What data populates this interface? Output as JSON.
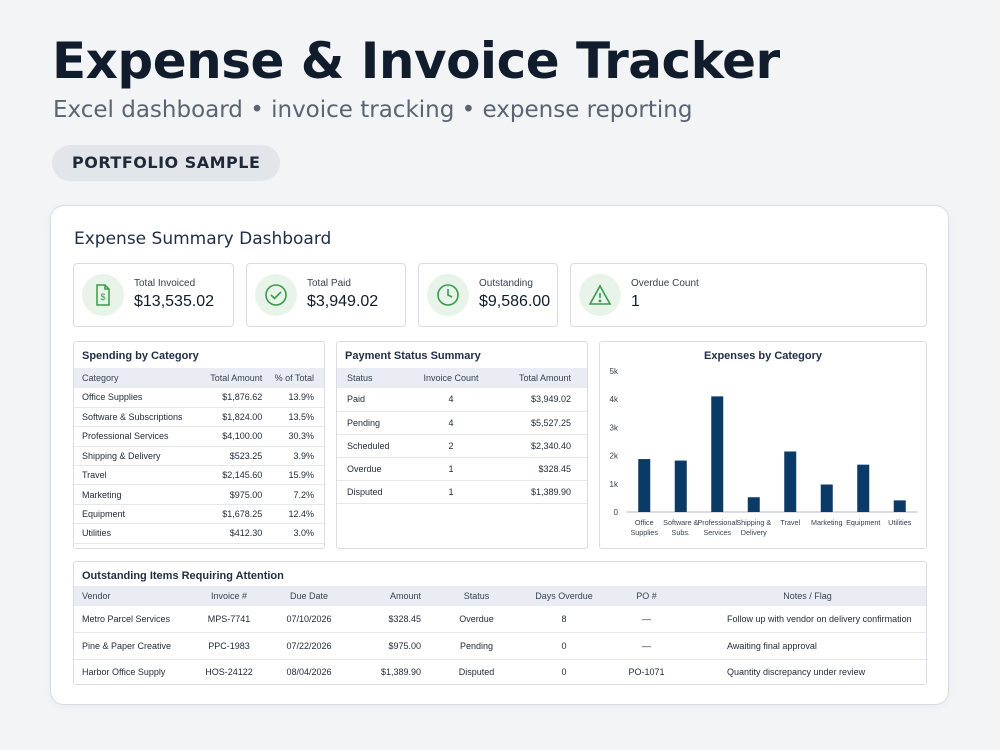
{
  "header": {
    "title": "Expense & Invoice Tracker",
    "subtitle": "Excel dashboard • invoice tracking • expense reporting",
    "badge": "PORTFOLIO SAMPLE"
  },
  "dashboard": {
    "title": "Expense Summary Dashboard",
    "kpis": [
      {
        "label": "Total Invoiced",
        "value": "$13,535.02",
        "icon": "document-dollar-icon"
      },
      {
        "label": "Total Paid",
        "value": "$3,949.02",
        "icon": "check-circle-icon"
      },
      {
        "label": "Outstanding",
        "value": "$9,586.00",
        "icon": "clock-icon"
      },
      {
        "label": "Overdue Count",
        "value": "1",
        "icon": "warning-triangle-icon"
      }
    ]
  },
  "spending": {
    "title": "Spending by Category",
    "headers": [
      "Category",
      "Total Amount",
      "% of Total"
    ],
    "rows": [
      [
        "Office Supplies",
        "$1,876.62",
        "13.9%"
      ],
      [
        "Software & Subscriptions",
        "$1,824.00",
        "13.5%"
      ],
      [
        "Professional Services",
        "$4,100.00",
        "30.3%"
      ],
      [
        "Shipping & Delivery",
        "$523.25",
        "3.9%"
      ],
      [
        "Travel",
        "$2,145.60",
        "15.9%"
      ],
      [
        "Marketing",
        "$975.00",
        "7.2%"
      ],
      [
        "Equipment",
        "$1,678.25",
        "12.4%"
      ],
      [
        "Utilities",
        "$412.30",
        "3.0%"
      ]
    ]
  },
  "payment": {
    "title": "Payment Status Summary",
    "headers": [
      "Status",
      "Invoice Count",
      "Total Amount"
    ],
    "rows": [
      [
        "Paid",
        "4",
        "$3,949.02"
      ],
      [
        "Pending",
        "4",
        "$5,527.25"
      ],
      [
        "Scheduled",
        "2",
        "$2,340.40"
      ],
      [
        "Overdue",
        "1",
        "$328.45"
      ],
      [
        "Disputed",
        "1",
        "$1,389.90"
      ]
    ]
  },
  "outstanding": {
    "title": "Outstanding Items Requiring Attention",
    "headers": [
      "Vendor",
      "Invoice #",
      "Due Date",
      "Amount",
      "Status",
      "Days Overdue",
      "PO #",
      "Notes / Flag"
    ],
    "rows": [
      [
        "Metro Parcel Services",
        "MPS-7741",
        "07/10/2026",
        "$328.45",
        "Overdue",
        "8",
        "—",
        "Follow up with vendor on delivery confirmation"
      ],
      [
        "Pine & Paper Creative",
        "PPC-1983",
        "07/22/2026",
        "$975.00",
        "Pending",
        "0",
        "—",
        "Awaiting final approval"
      ],
      [
        "Harbor Office Supply",
        "HOS-24122",
        "08/04/2026",
        "$1,389.90",
        "Disputed",
        "0",
        "PO-1071",
        "Quantity discrepancy under review"
      ]
    ]
  },
  "chart_data": {
    "type": "bar",
    "title": "Expenses by Category",
    "categories": [
      [
        "Office",
        "Supplies"
      ],
      [
        "Software &",
        "Subs."
      ],
      [
        "Professional",
        "Services"
      ],
      [
        "Shipping &",
        "Delivery"
      ],
      [
        "Travel"
      ],
      [
        "Marketing"
      ],
      [
        "Equipment"
      ],
      [
        "Utilities"
      ]
    ],
    "values": [
      1876.62,
      1824.0,
      4100.0,
      523.25,
      2145.6,
      975.0,
      1678.25,
      412.3
    ],
    "ylim": [
      0,
      5000
    ],
    "yticks": [
      "0",
      "1k",
      "2k",
      "3k",
      "4k",
      "5k"
    ],
    "bar_color": "#0b3a66",
    "grid": false
  }
}
